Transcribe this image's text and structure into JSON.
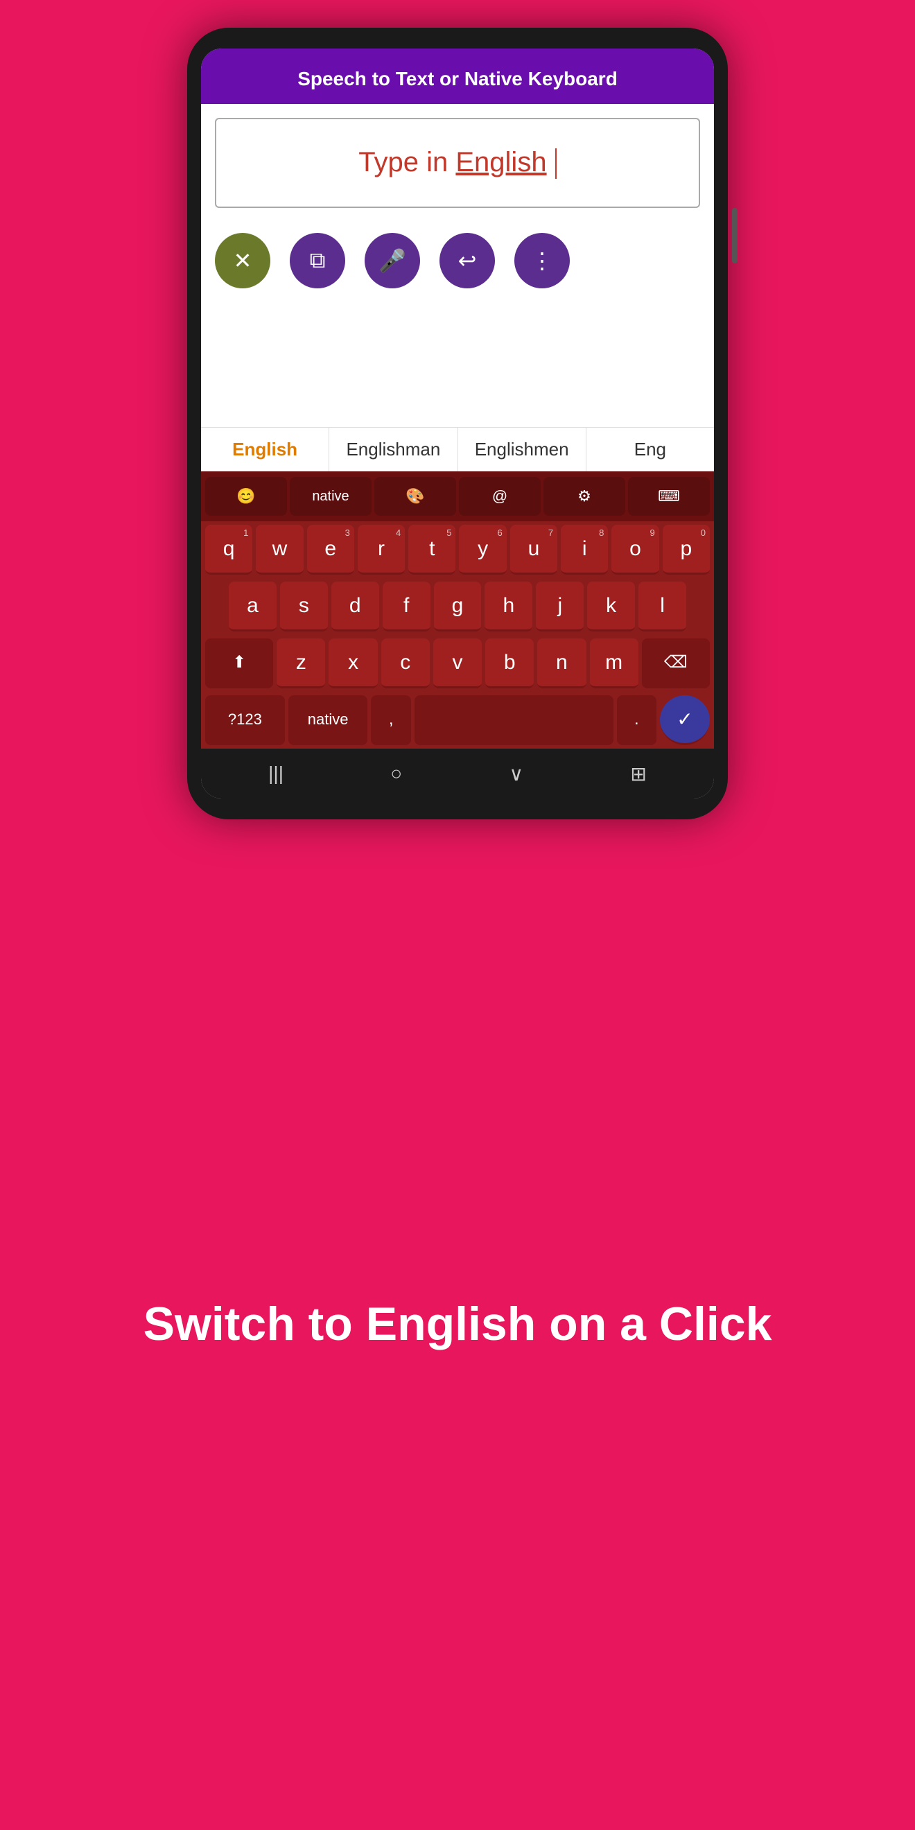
{
  "header": {
    "title": "Speech to Text or Native Keyboard"
  },
  "textbox": {
    "content_prefix": "Type in ",
    "content_word": "English"
  },
  "action_buttons": [
    {
      "id": "delete",
      "label": "✕",
      "icon": "delete-icon",
      "class": "btn-delete"
    },
    {
      "id": "copy",
      "label": "⧉",
      "icon": "copy-icon",
      "class": "btn-copy"
    },
    {
      "id": "mic",
      "label": "🎤",
      "icon": "mic-icon",
      "class": "btn-mic"
    },
    {
      "id": "undo",
      "label": "↩",
      "icon": "undo-icon",
      "class": "btn-undo"
    },
    {
      "id": "share",
      "label": "⋮",
      "icon": "share-icon",
      "class": "btn-share"
    }
  ],
  "suggestions": [
    {
      "text": "English",
      "active": true
    },
    {
      "text": "Englishman",
      "active": false
    },
    {
      "text": "Englishmen",
      "active": false
    },
    {
      "text": "Eng",
      "active": false
    }
  ],
  "keyboard_top_row": [
    {
      "id": "emoji",
      "label": "😊"
    },
    {
      "id": "native",
      "label": "native"
    },
    {
      "id": "palette",
      "label": "🎨"
    },
    {
      "id": "at",
      "label": "@"
    },
    {
      "id": "settings",
      "label": "⚙"
    },
    {
      "id": "keyboard2",
      "label": "⌨"
    }
  ],
  "keyboard_rows": {
    "row1": [
      {
        "key": "q",
        "num": "1"
      },
      {
        "key": "w",
        "num": ""
      },
      {
        "key": "e",
        "num": "3"
      },
      {
        "key": "r",
        "num": "4"
      },
      {
        "key": "t",
        "num": "5"
      },
      {
        "key": "y",
        "num": "6"
      },
      {
        "key": "u",
        "num": "7"
      },
      {
        "key": "i",
        "num": "8"
      },
      {
        "key": "o",
        "num": "9"
      },
      {
        "key": "p",
        "num": "0"
      }
    ],
    "row2": [
      {
        "key": "a"
      },
      {
        "key": "s"
      },
      {
        "key": "d"
      },
      {
        "key": "f"
      },
      {
        "key": "g"
      },
      {
        "key": "h"
      },
      {
        "key": "j"
      },
      {
        "key": "k"
      },
      {
        "key": "l"
      }
    ],
    "row3_left": {
      "key": "⬆",
      "special": true
    },
    "row3_mid": [
      {
        "key": "z"
      },
      {
        "key": "x"
      },
      {
        "key": "c"
      },
      {
        "key": "v"
      },
      {
        "key": "b"
      },
      {
        "key": "n"
      },
      {
        "key": "m"
      }
    ],
    "row3_right": {
      "key": "⌫",
      "special": true
    },
    "row4": {
      "symbols": "?123",
      "native": "native",
      "comma": ",",
      "space": "",
      "period": ".",
      "enter": "✓"
    }
  },
  "nav_bar": {
    "back": "|||",
    "home": "○",
    "recent": "∨",
    "keyboard_switch": "⊞"
  },
  "bottom_headline": "Switch to English on a Click"
}
